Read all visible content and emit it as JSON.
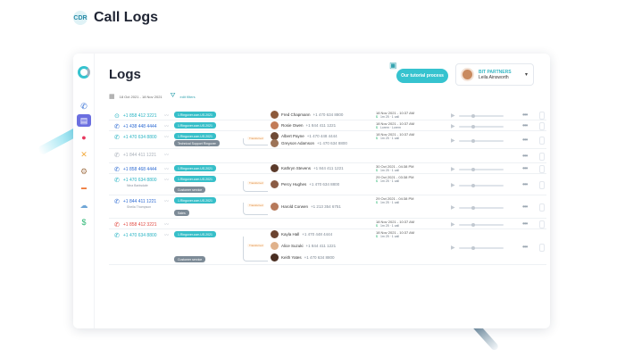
{
  "header": {
    "icon_label": "CDR",
    "title": "Call Logs"
  },
  "page": {
    "title": "Logs"
  },
  "tutorial": {
    "label": "Our tutorial process"
  },
  "account": {
    "company": "BIT PARTNERS",
    "name": "Leila Ainsworth"
  },
  "filters": {
    "date_range": "18 Oct 2021 - 18 Nov 2021",
    "edit_label": "edit filters"
  },
  "sidebar": {
    "icons": [
      "logo-icon",
      "phone-icon",
      "logs-icon",
      "analytics-icon",
      "tools-icon",
      "settings-icon",
      "sms-icon",
      "cloud-icon",
      "billing-icon"
    ]
  },
  "rows": [
    {
      "number": "+1 858 412 3221",
      "number_color": "teal",
      "icon": "voicemail-icon",
      "sub": "",
      "tags": [
        {
          "text": "1.Ringover.com.US.2021",
          "kind": "teal"
        }
      ],
      "people": [
        {
          "name": "Fred Chapmann",
          "phone": "+1 470 634 8800",
          "avatar": "#8d5a3b"
        }
      ],
      "dt": "18 Nov 2021 - 10:37 AM",
      "meta": "1m 25 · 1 call",
      "extra": ""
    },
    {
      "number": "+1 438 448 4444",
      "number_color": "blue",
      "icon": "phone-in-icon",
      "sub": "",
      "tags": [
        {
          "text": "1.Ringover.com.US.2021",
          "kind": "teal"
        }
      ],
      "people": [
        {
          "name": "Rosie Owen",
          "phone": "+1 844 411 1221",
          "avatar": "#c27b57"
        }
      ],
      "dt": "18 Nov 2021 - 10:37 AM",
      "meta": "Lorem · Lorem",
      "extra": ""
    },
    {
      "number": "+1 470 634 8800",
      "number_color": "teal",
      "icon": "phone-out-icon",
      "sub": "",
      "tags": [
        {
          "text": "1.Ringover.com.US.2021",
          "kind": "teal"
        },
        {
          "text": "Technical Support Ringover",
          "kind": "grey"
        }
      ],
      "people": [
        {
          "name": "Albert Payne",
          "phone": "+1 470 448 4444",
          "avatar": "#6e4a36"
        },
        {
          "name": "Greyson Adamson",
          "phone": "+1 470 634 8800",
          "avatar": "#9c7357"
        }
      ],
      "dt": "18 Nov 2021 - 10:37 AM",
      "meta": "1m 25 · 1 call",
      "extra": ""
    },
    {
      "number": "+1 844 411 1221",
      "number_color": "grey",
      "icon": "missed-icon",
      "sub": "",
      "tags": [],
      "people": [],
      "dt": "",
      "meta": "",
      "extra": ""
    },
    {
      "number": "+1 858 468 4444",
      "number_color": "blue",
      "icon": "phone-in-icon",
      "sub": "",
      "tags": [
        {
          "text": "1.Ringover.com.US.2021",
          "kind": "teal"
        }
      ],
      "people": [
        {
          "name": "Kathryn Stevens",
          "phone": "+1 844 411 1221",
          "avatar": "#5b3a2a"
        }
      ],
      "dt": "30 Oct 2021 - 04:38 PM",
      "meta": "1m 25 · 1 call",
      "extra": ""
    },
    {
      "number": "+1 470 634 8800",
      "number_color": "teal",
      "icon": "phone-out-icon",
      "sub": "Nina Barksdale",
      "tags": [
        {
          "text": "1.Ringover.com.US.2021",
          "kind": "teal"
        },
        {
          "text": "Customer service",
          "kind": "grey"
        }
      ],
      "people": [
        {
          "name": "Percy Hughes",
          "phone": "+1 470 634 8800",
          "avatar": "#8a5b44"
        }
      ],
      "dt": "29 Oct 2021 - 03:38 PM",
      "meta": "1m 25 · 1 call",
      "extra": ""
    },
    {
      "number": "+1 844 411 1221",
      "number_color": "blue",
      "icon": "phone-in-icon",
      "sub": "Sheila Thompson",
      "tags": [
        {
          "text": "1.Ringover.com.US.2021",
          "kind": "teal"
        },
        {
          "text": "Sales",
          "kind": "grey"
        }
      ],
      "people": [
        {
          "name": "Harold Corwen",
          "phone": "+1 213 354 6751",
          "avatar": "#b77a5b"
        }
      ],
      "dt": "29 Oct 2021 - 04:38 PM",
      "meta": "1m 25 · 1 call",
      "extra": ""
    },
    {
      "number": "+1 858 412 3221",
      "number_color": "red",
      "icon": "missed-icon",
      "sub": "",
      "tags": [],
      "people": [],
      "dt": "18 Nov 2021 - 10:37 AM",
      "meta": "1m 25 · 1 call",
      "extra": ""
    },
    {
      "number": "+1 470 634 8800",
      "number_color": "teal",
      "icon": "phone-out-icon",
      "sub": "",
      "tags": [
        {
          "text": "1.Ringover.com.US.2021",
          "kind": "teal"
        },
        {
          "text": "Customer service",
          "kind": "grey"
        }
      ],
      "people": [
        {
          "name": "Kayla Hall",
          "phone": "+1 470 448 4444",
          "avatar": "#6b4330"
        },
        {
          "name": "Alice Suzuki",
          "phone": "+1 844 411 1221",
          "avatar": "#e0b28c"
        },
        {
          "name": "Keith Yates",
          "phone": "+1 470 634 8800",
          "avatar": "#4a2e22"
        }
      ],
      "dt": "18 Nov 2021 - 10:37 AM",
      "meta": "1m 25 · 1 call",
      "extra": ""
    }
  ],
  "colors": {
    "accent": "#37bfc9",
    "blue": "#2e6bd3",
    "red": "#e0473f",
    "grey": "#a9b0b9"
  },
  "transfer_label": "Transferred"
}
